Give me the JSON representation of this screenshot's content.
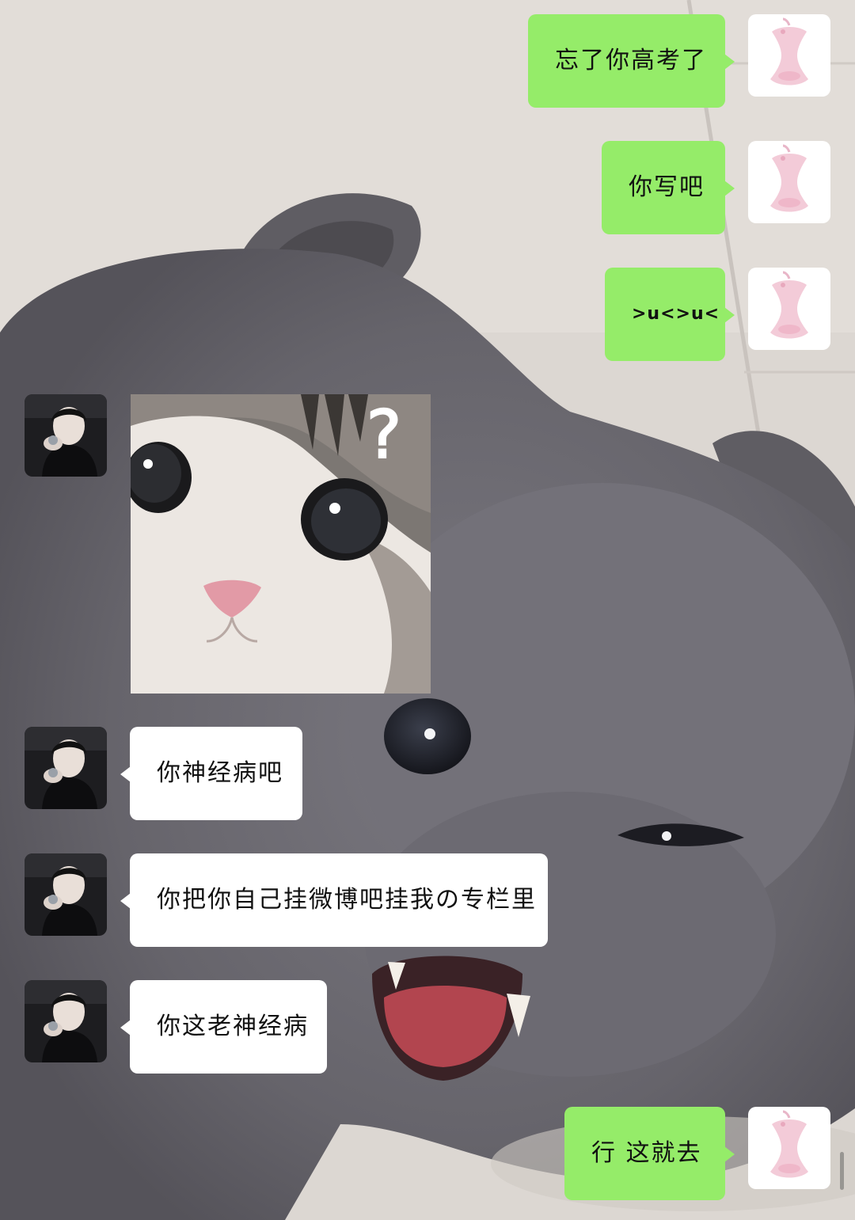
{
  "chat": {
    "messages": [
      {
        "from": "me",
        "type": "text",
        "text": "忘了你高考了"
      },
      {
        "from": "me",
        "type": "text",
        "text": "你写吧"
      },
      {
        "from": "me",
        "type": "text",
        "text": ">u<>u<"
      },
      {
        "from": "other",
        "type": "sticker",
        "sticker_icon": "question-kitten-sticker",
        "text": "?"
      },
      {
        "from": "other",
        "type": "text",
        "text": "你神经病吧"
      },
      {
        "from": "other",
        "type": "text",
        "text": "你把你自己挂微博吧挂我の专栏里"
      },
      {
        "from": "other",
        "type": "text",
        "text": "你这老神经病"
      },
      {
        "from": "me",
        "type": "text",
        "text": "行 这就去"
      }
    ]
  },
  "colors": {
    "my_bubble": "#95ec69",
    "other_bubble": "#ffffff",
    "background_wall": "#d8d3ce",
    "cat_fur": "#6f6d74"
  },
  "icons": {
    "my_avatar": "pink-apple-core-avatar-icon",
    "other_avatar": "person-photo-avatar-icon",
    "background": "angry-grey-cat-wallpaper"
  }
}
